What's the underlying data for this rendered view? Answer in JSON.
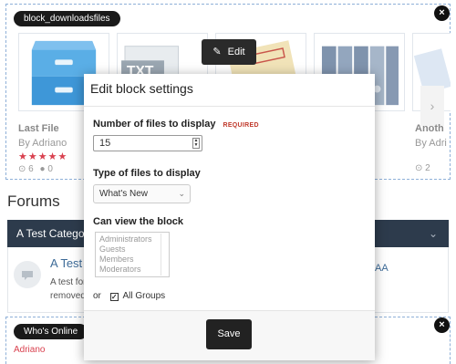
{
  "downloads_block": {
    "badge": "block_downloadsfiles",
    "close": "×",
    "edit_label": "Edit",
    "cards": [
      {
        "title": "Last File",
        "author": "By Adriano",
        "stars": "★★★★★",
        "views": "6",
        "comments": "0"
      },
      {
        "title": "Anoth",
        "author": "By Adri",
        "views": "2"
      }
    ],
    "next_arrow": "›",
    "txt_label": "TXT"
  },
  "forums": {
    "title": "Forums",
    "category": "A Test Category",
    "forum_name": "A Test F",
    "forum_desc": "A test for removed",
    "right_text": "AA",
    "chevron": "⌄"
  },
  "whos_online": {
    "badge": "Who's Online",
    "user": "Adriano",
    "close": "×"
  },
  "modal": {
    "title": "Edit block settings",
    "num_label": "Number of files to display",
    "required": "REQUIRED",
    "num_value": "15",
    "type_label": "Type of files to display",
    "type_value": "What's New",
    "view_label": "Can view the block",
    "groups": [
      "Administrators",
      "Guests",
      "Members",
      "Moderators"
    ],
    "or_text": "or",
    "all_groups": "All Groups",
    "save": "Save"
  }
}
